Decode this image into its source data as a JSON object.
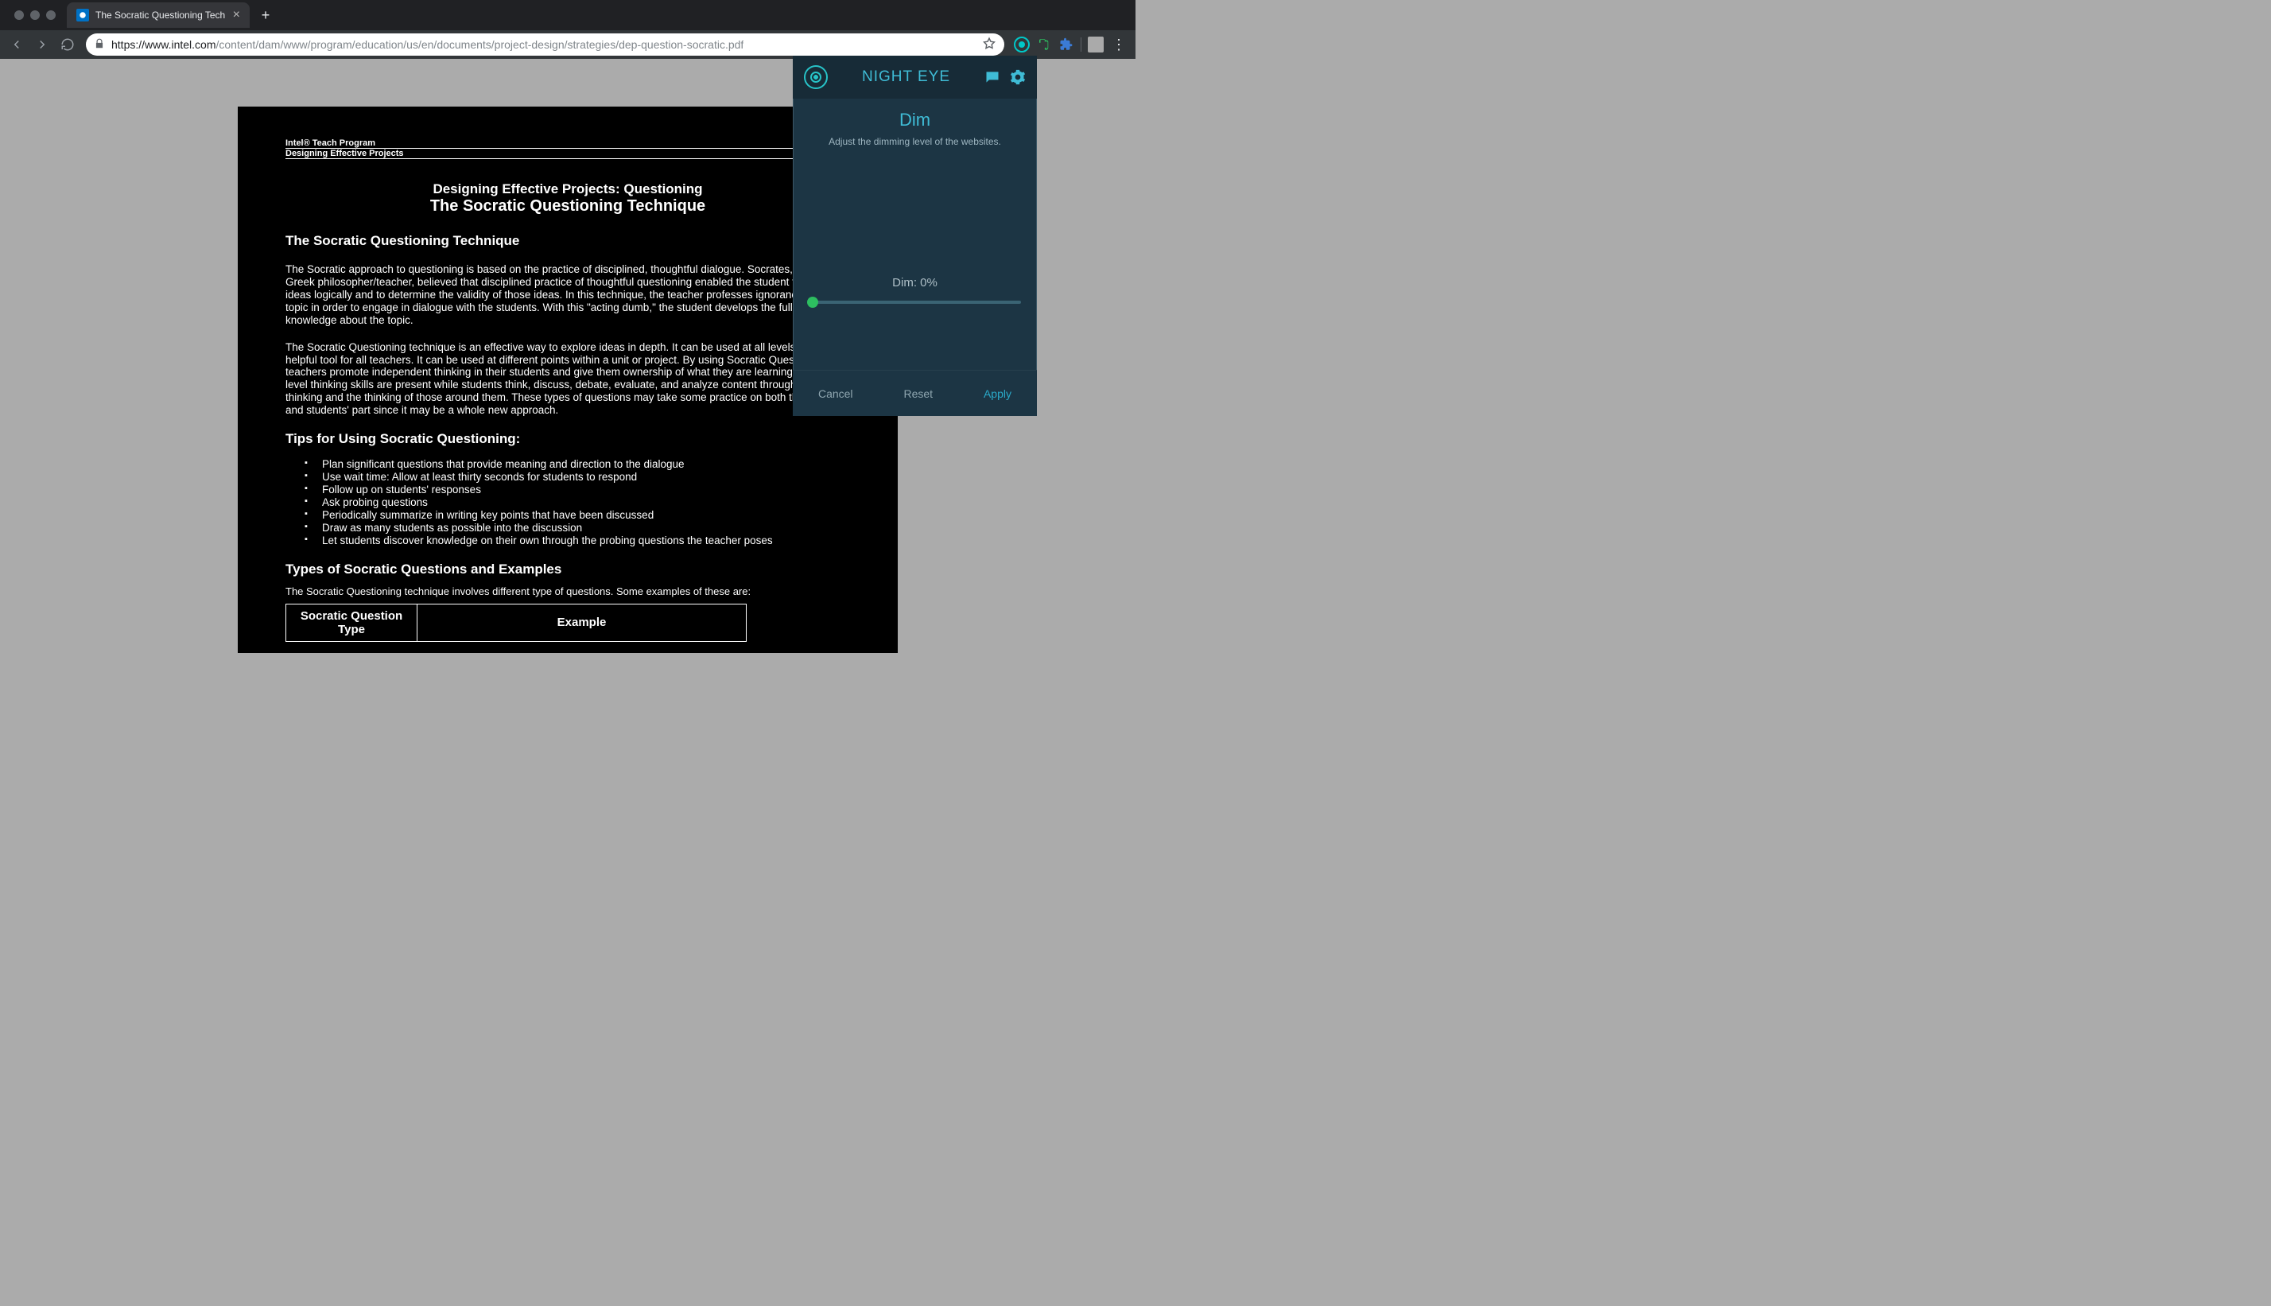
{
  "browser": {
    "tab_title": "The Socratic Questioning Tech",
    "url_host": "https://www.intel.com",
    "url_path": "/content/dam/www/program/education/us/en/documents/project-design/strategies/dep-question-socratic.pdf"
  },
  "document": {
    "header_line1": "Intel® Teach Program",
    "header_line2": "Designing Effective Projects",
    "title_line1": "Designing Effective Projects: Questioning",
    "title_line2": "The Socratic Questioning Technique",
    "section_heading": "The Socratic Questioning Technique",
    "para1": "The Socratic approach to questioning is based on the practice of disciplined, thoughtful dialogue. Socrates, the early Greek philosopher/teacher, believed that disciplined practice of thoughtful questioning enabled the student to examine ideas logically and to determine the validity of those ideas. In this technique, the teacher professes ignorance of the topic in order to engage in dialogue with the students. With this \"acting dumb,\" the student develops the fullest possible knowledge about the topic.",
    "para2": "The Socratic Questioning technique is an effective way to explore ideas in depth. It can be used at all levels and is a helpful tool for all teachers. It can be used at different points within a unit or project. By using Socratic Questioning, teachers promote independent thinking in their students and give them ownership of what they are learning. Higher-level thinking skills are present while students think, discuss, debate, evaluate, and analyze content through their own thinking and the thinking of those around them. These types of questions may take some practice on both the teacher and students' part since it may be a whole new approach.",
    "tips_heading": "Tips for Using Socratic Questioning:",
    "tips": [
      "Plan significant questions that provide meaning and direction to the dialogue",
      "Use wait time: Allow at least thirty seconds for students to respond",
      "Follow up on students' responses",
      "Ask probing questions",
      "Periodically summarize in writing key points that have been discussed",
      "Draw as many students as possible into the discussion",
      "Let students discover knowledge on their own through the probing questions the teacher poses"
    ],
    "types_heading": "Types of Socratic Questions and Examples",
    "types_lead": "The Socratic Questioning technique involves different type of questions. Some examples of these are:",
    "table_header1": "Socratic Question Type",
    "table_header2": "Example"
  },
  "popup": {
    "brand": "NIGHT EYE",
    "heading": "Dim",
    "sub": "Adjust the dimming level of the websites.",
    "dim_label": "Dim: 0%",
    "cancel": "Cancel",
    "reset": "Reset",
    "apply": "Apply"
  }
}
